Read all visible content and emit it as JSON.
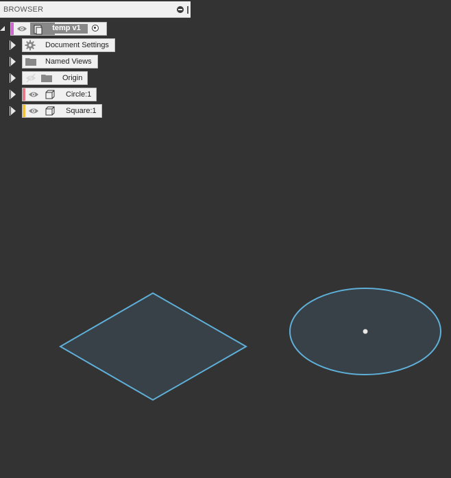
{
  "browser": {
    "title": "BROWSER",
    "root": {
      "label": "temp v1"
    },
    "items": [
      {
        "label": "Document Settings",
        "icon": "gear-icon"
      },
      {
        "label": "Named Views",
        "icon": "folder-icon"
      },
      {
        "label": "Origin",
        "icon": "folder-icon",
        "visible": false
      },
      {
        "label": "Circle:1",
        "icon": "component-icon",
        "accent": "#e57b8a"
      },
      {
        "label": "Square:1",
        "icon": "component-icon",
        "accent": "#f0c040"
      }
    ]
  },
  "colors": {
    "canvas_background": "#333333",
    "sketch_fill": "#384048",
    "sketch_stroke": "#5fb0d8",
    "root_accent": "#cc66cc"
  }
}
